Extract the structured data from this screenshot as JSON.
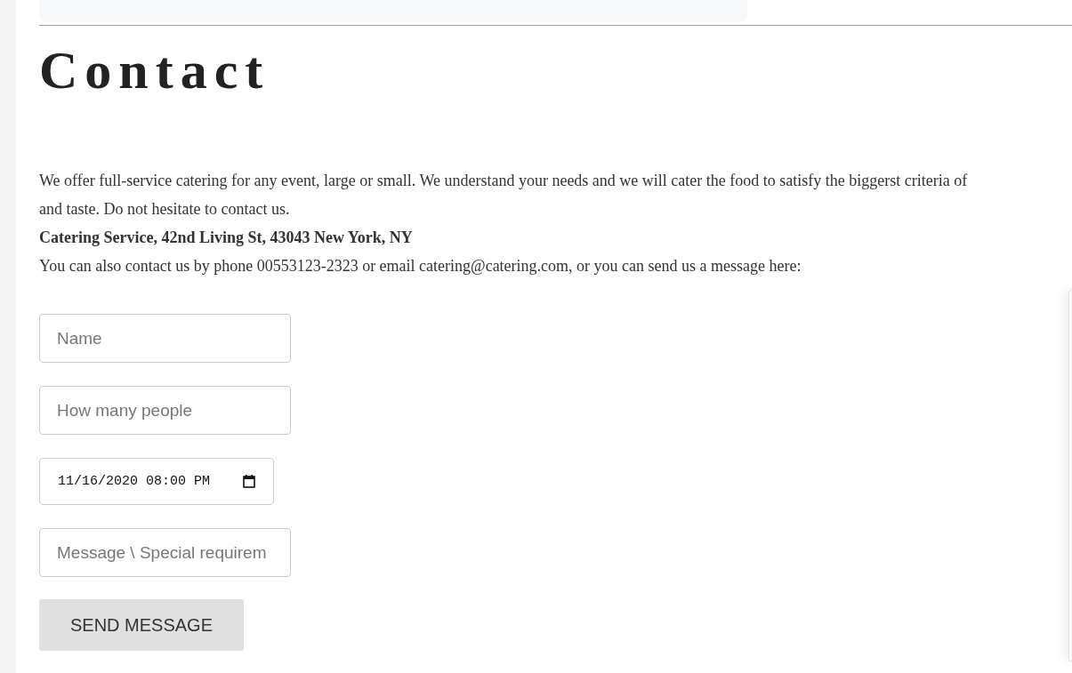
{
  "heading": "Contact",
  "intro_lines": [
    "We offer full-service catering for any event, large or small. We understand your needs and we will cater the food to satisfy the biggerst criteria of",
    "and taste. Do not hesitate to contact us."
  ],
  "address": "Catering Service, 42nd Living St, 43043 New York, NY",
  "contact_line": "You can also contact us by phone 00553123-2323 or email catering@catering.com, or you can send us a message here:",
  "form": {
    "fields": [
      {
        "kind": "text",
        "placeholder": "Name"
      },
      {
        "kind": "text",
        "placeholder": "How many people"
      },
      {
        "kind": "datetime",
        "value": "11/16/2020 08:00 PM"
      },
      {
        "kind": "text",
        "placeholder": "Message \\ Special requirem"
      }
    ],
    "submit": "SEND MESSAGE"
  }
}
